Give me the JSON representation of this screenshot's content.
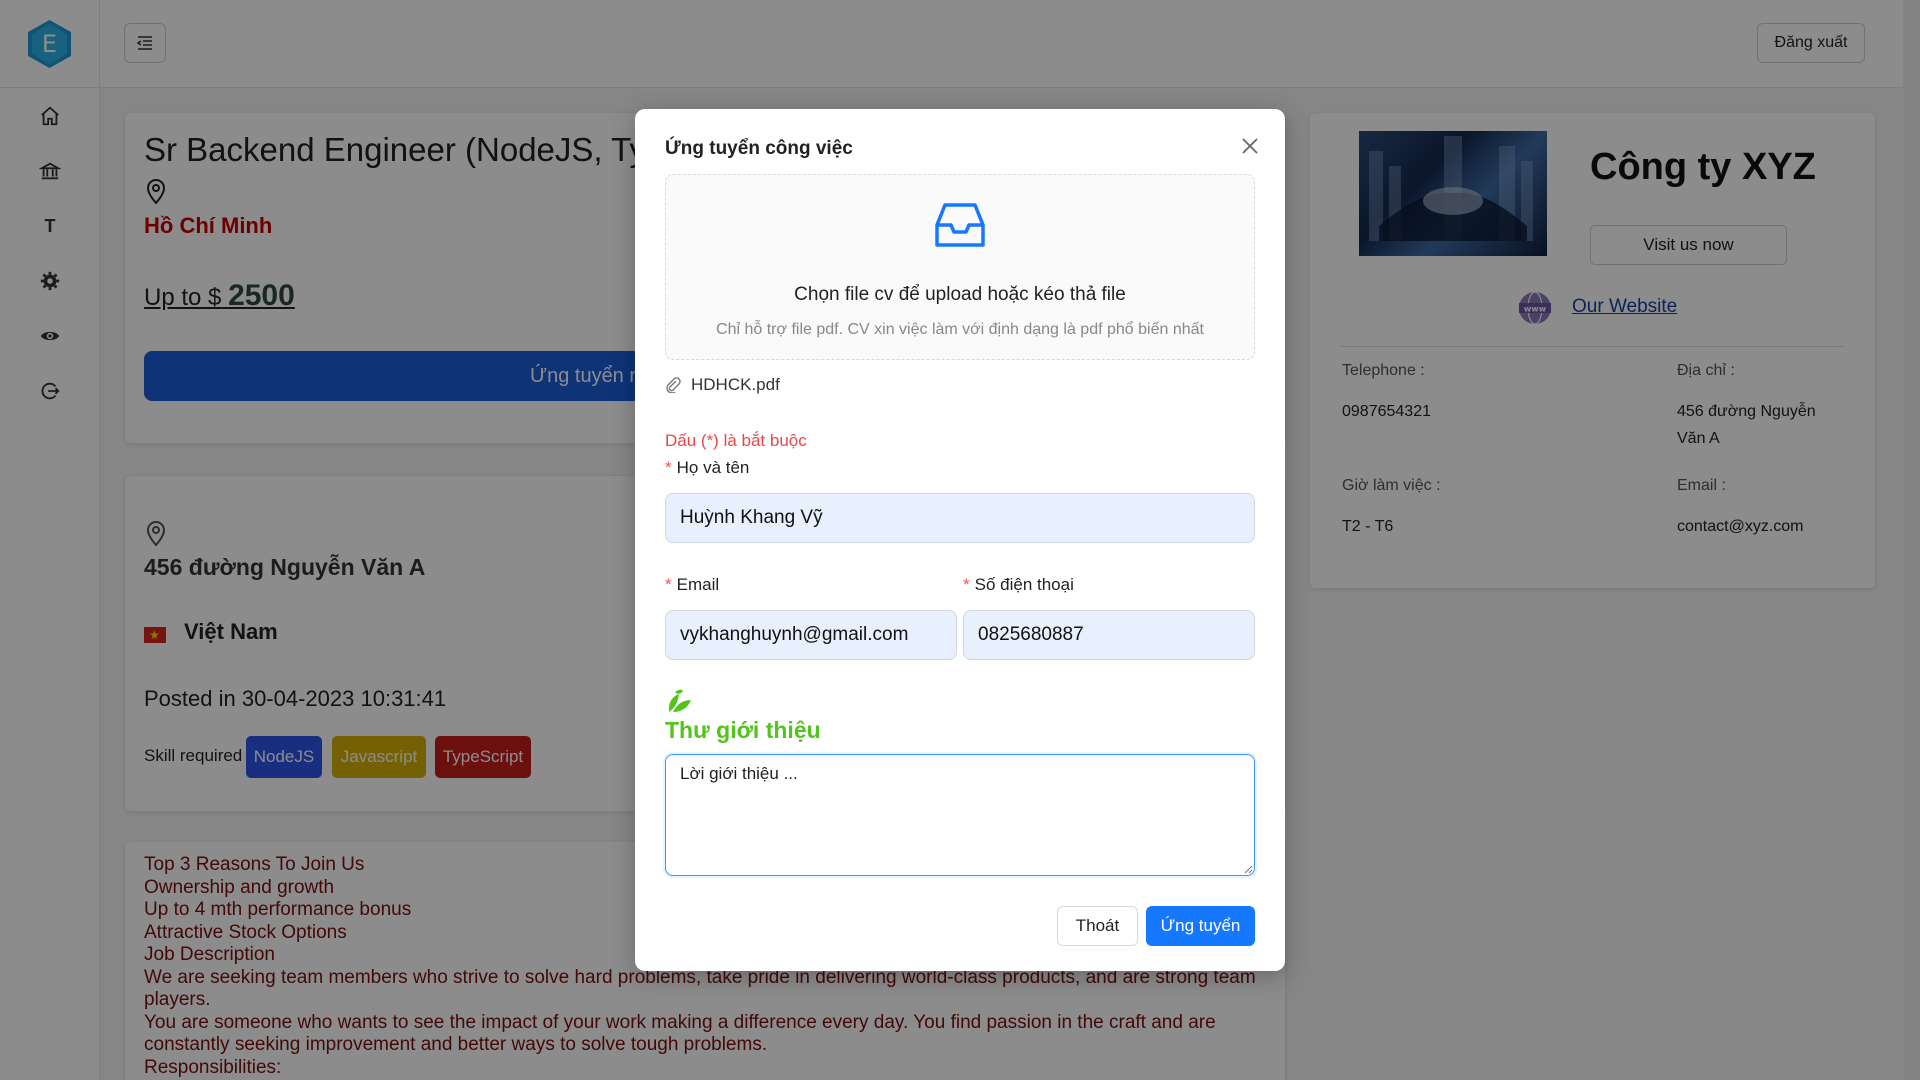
{
  "sidebar": {
    "logo_letter": "E",
    "items": [
      {
        "name": "home-icon"
      },
      {
        "name": "bank-icon"
      },
      {
        "name": "text-icon",
        "label": "T"
      },
      {
        "name": "gear-icon"
      },
      {
        "name": "eye-icon"
      },
      {
        "name": "logout-icon"
      }
    ]
  },
  "header": {
    "logout_label": "Đăng xuất"
  },
  "job": {
    "title": "Sr Backend Engineer (NodeJS, TypeScript)",
    "city": "Hồ Chí Minh",
    "salary_prefix": "Up to $",
    "salary_value": "2500",
    "apply_label": "Ứng tuyển ngay"
  },
  "info": {
    "address": "456 đường Nguyễn Văn A",
    "country": "Việt Nam",
    "posted": "Posted in 30-04-2023 10:31:41",
    "skill_label": "Skill required :",
    "skills": [
      {
        "label": "NodeJS",
        "color": "#2f54eb"
      },
      {
        "label": "Javascript",
        "color": "#d4b106"
      },
      {
        "label": "TypeScript",
        "color": "#c41d1d"
      }
    ]
  },
  "description": {
    "lines": [
      "Top 3 Reasons To Join Us",
      "Ownership and growth",
      "Up to 4 mth performance bonus",
      "Attractive Stock Options",
      "Job Description",
      "We are seeking team members who strive to solve hard problems, take pride in delivering world-class products, and are strong team",
      "players.",
      "You are someone who wants to see the impact of your work making a difference every day. You find passion in the craft and are",
      "constantly seeking improvement and better ways to solve tough problems.",
      "Responsibilities:"
    ]
  },
  "company": {
    "name": "Công ty XYZ",
    "visit_label": "Visit us now",
    "website_label": "Our Website",
    "telephone_label": "Telephone :",
    "telephone": "0987654321",
    "address_label": "Địa chỉ :",
    "address": "456 đường Nguyễn Văn A",
    "hours_label": "Giờ làm việc :",
    "hours": "T2 - T6",
    "email_label": "Email :",
    "email": "contact@xyz.com"
  },
  "modal": {
    "title": "Ứng tuyển công việc",
    "upload_main": "Chọn file cv để upload hoặc kéo thả file",
    "upload_hint": "Chỉ hỗ trợ file pdf. CV xin việc làm với định dạng là pdf phổ biến nhất",
    "file_name": "HDHCK.pdf",
    "required_note": "Dấu (*) là bắt buộc",
    "name_label": "Họ và tên",
    "name_value": "Huỳnh Khang Vỹ",
    "email_label": "Email",
    "email_value": "vykhanghuynh@gmail.com",
    "phone_label": "Số điện thoại",
    "phone_value": "0825680887",
    "letter_title": "Thư giới thiệu",
    "letter_value": "Lời giới thiệu ... ",
    "cancel_label": "Thoát",
    "submit_label": "Ứng tuyển"
  },
  "colors": {
    "primary": "#1677ff",
    "job_button": "#1b5ed8",
    "city": "#c40000",
    "letter_title": "#52c41a",
    "required": "#ff4d4f"
  }
}
